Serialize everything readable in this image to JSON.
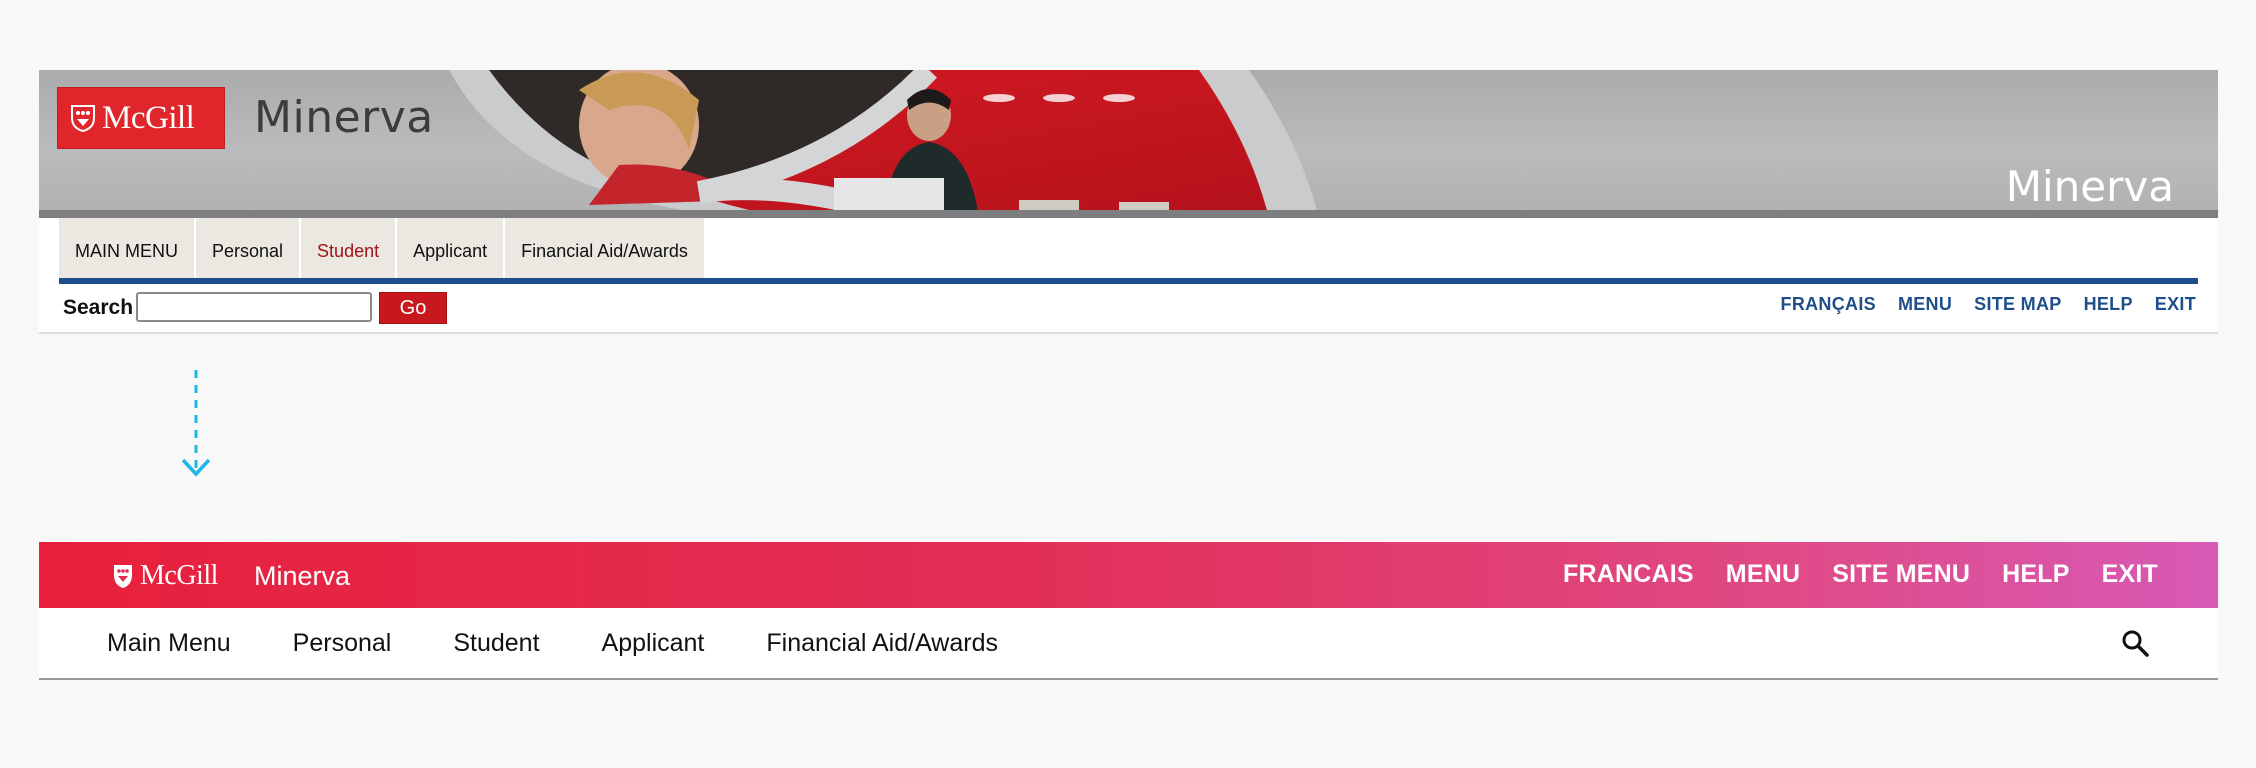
{
  "old_design": {
    "logo_text": "McGill",
    "site_title_left": "Minerva",
    "site_title_right": "Minerva",
    "tabs": [
      {
        "label": "MAIN MENU",
        "active": false
      },
      {
        "label": "Personal",
        "active": false
      },
      {
        "label": "Student",
        "active": true
      },
      {
        "label": "Applicant",
        "active": false
      },
      {
        "label": "Financial Aid/Awards",
        "active": false
      }
    ],
    "search": {
      "label": "Search",
      "value": "",
      "button_label": "Go"
    },
    "utility_links": [
      "FRANÇAIS",
      "MENU",
      "SITE MAP",
      "HELP",
      "EXIT"
    ],
    "colors": {
      "logo_red": "#e0262b",
      "nav_blue": "#1f4f8a",
      "active_tab": "#a01418"
    }
  },
  "transition_icon": "arrow-down-icon",
  "new_design": {
    "logo_text": "McGill",
    "site_title": "Minerva",
    "utility_links": [
      "FRANCAIS",
      "MENU",
      "SITE MENU",
      "HELP",
      "EXIT"
    ],
    "tabs": [
      "Main Menu",
      "Personal",
      "Student",
      "Applicant",
      "Financial Aid/Awards"
    ],
    "search_icon": "search-icon",
    "colors": {
      "gradient_start": "#e8203c",
      "gradient_end": "#d75ab6"
    }
  }
}
